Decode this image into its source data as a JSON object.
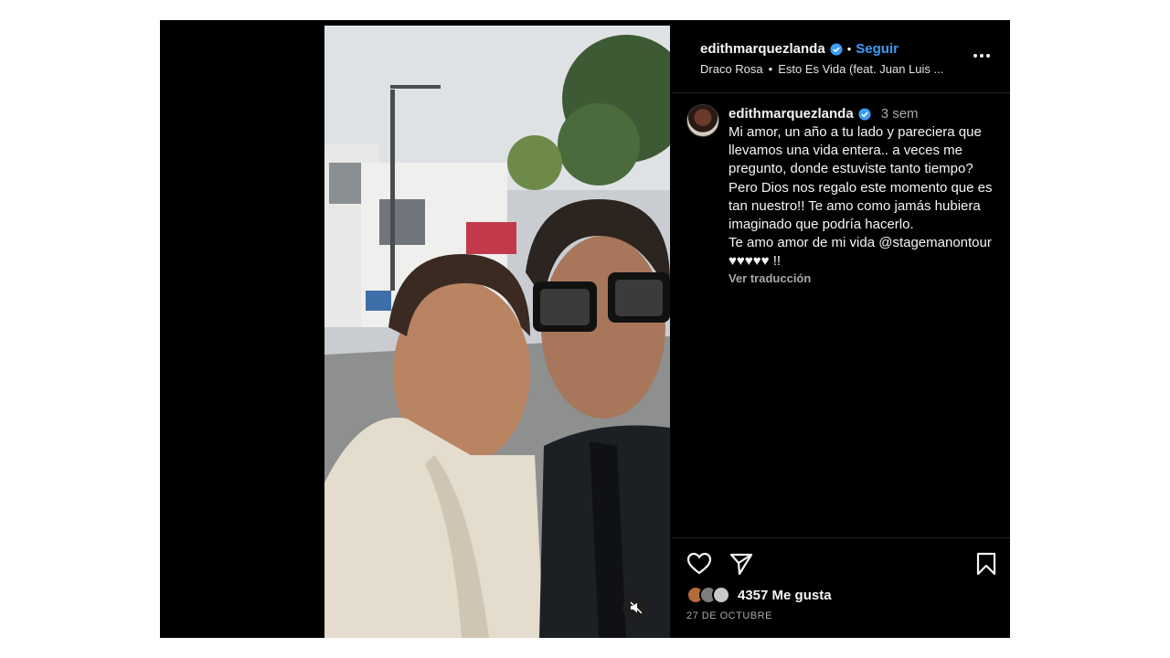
{
  "header": {
    "username": "edithmarquezlanda",
    "separator": "•",
    "follow_label": "Seguir",
    "audio_artist": "Draco Rosa",
    "audio_separator": "•",
    "audio_track": "Esto Es Vida (feat. Juan Luis ..."
  },
  "caption": {
    "username": "edithmarquezlanda",
    "time_ago": "3 sem",
    "text": "Mi amor, un año a tu lado y pareciera que llevamos una vida entera.. a veces me pregunto, donde estuviste tanto tiempo? Pero Dios nos regalo este momento que es tan nuestro!! Te amo como jamás hubiera imaginado que podría hacerlo.\nTe amo amor de mi vida @stagemanontour ♥♥♥♥♥ !!",
    "translate_label": "Ver traducción"
  },
  "engagement": {
    "likes_label": "4357 Me gusta",
    "date": "27 DE OCTUBRE"
  },
  "icons": {
    "verified": "verified-badge-icon",
    "more": "more-options-icon",
    "like": "heart-icon",
    "share": "send-icon",
    "save": "bookmark-icon",
    "mute": "muted-speaker-icon"
  },
  "colors": {
    "accent": "#3c9cf7",
    "background": "#000000",
    "text": "#f5f5f5",
    "muted": "#a8a8a8"
  }
}
